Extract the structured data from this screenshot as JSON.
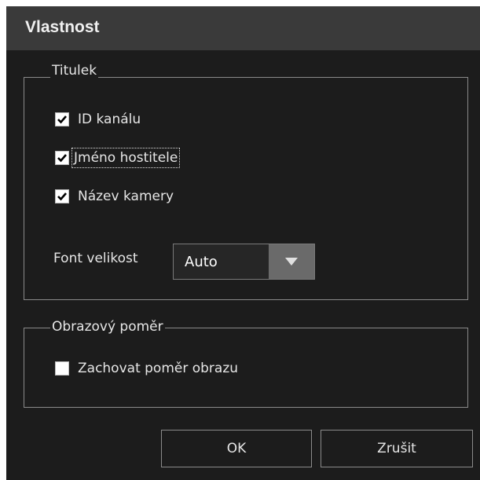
{
  "dialog": {
    "title": "Vlastnost"
  },
  "titulek": {
    "legend": "Titulek",
    "checkboxes": [
      {
        "label": "ID kanálu",
        "checked": true
      },
      {
        "label": "Jméno hostitele",
        "checked": true
      },
      {
        "label": "Název kamery",
        "checked": true
      }
    ],
    "font_label": "Font velikost",
    "font_value": "Auto"
  },
  "pomer": {
    "legend": "Obrazový poměr",
    "checkbox": {
      "label": "Zachovat poměr obrazu",
      "checked": false
    }
  },
  "buttons": {
    "ok": "OK",
    "cancel": "Zrušit"
  },
  "colors": {
    "background": "#1c1c1c",
    "titlebar": "#3a3a3a",
    "border": "#8a8a8a",
    "dropdown_button": "#6a6a6a"
  }
}
